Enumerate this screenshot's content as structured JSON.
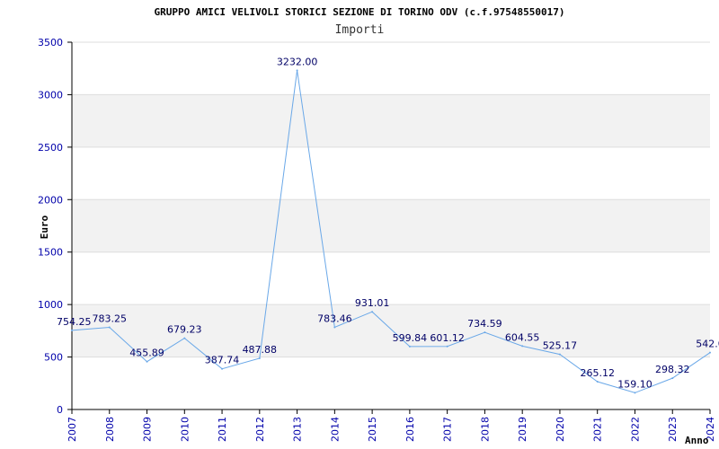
{
  "chart_data": {
    "type": "line",
    "title": "GRUPPO AMICI VELIVOLI STORICI SEZIONE DI TORINO ODV (c.f.97548550017)",
    "subtitle": "Importi",
    "xlabel": "Anno",
    "ylabel": "Euro",
    "categories": [
      "2007",
      "2008",
      "2009",
      "2010",
      "2011",
      "2012",
      "2013",
      "2014",
      "2015",
      "2016",
      "2017",
      "2018",
      "2019",
      "2020",
      "2021",
      "2022",
      "2023",
      "2024"
    ],
    "series": [
      {
        "values": [
          754.25,
          783.25,
          455.89,
          679.23,
          387.74,
          487.88,
          3232.0,
          783.46,
          931.01,
          599.84,
          601.12,
          734.59,
          604.55,
          525.17,
          265.12,
          159.1,
          298.32,
          542.0
        ],
        "labels": [
          "754.25",
          "783.25",
          "455.89",
          "679.23",
          "387.74",
          "487.88",
          "3232.00",
          "783.46",
          "931.01",
          "599.84",
          "601.12",
          "734.59",
          "604.55",
          "525.17",
          "265.12",
          "159.10",
          "298.32",
          "542.0"
        ]
      }
    ],
    "ylim": [
      0,
      3500
    ],
    "yticks": [
      "0",
      "500",
      "1000",
      "1500",
      "2000",
      "2500",
      "3000",
      "3500"
    ],
    "grid": "horizontal bands",
    "colors": {
      "line": "#6aa8e8",
      "band": "#f2f2f2",
      "axis": "#000000",
      "tick_text": "#0000aa",
      "label_text": "#000066"
    }
  }
}
